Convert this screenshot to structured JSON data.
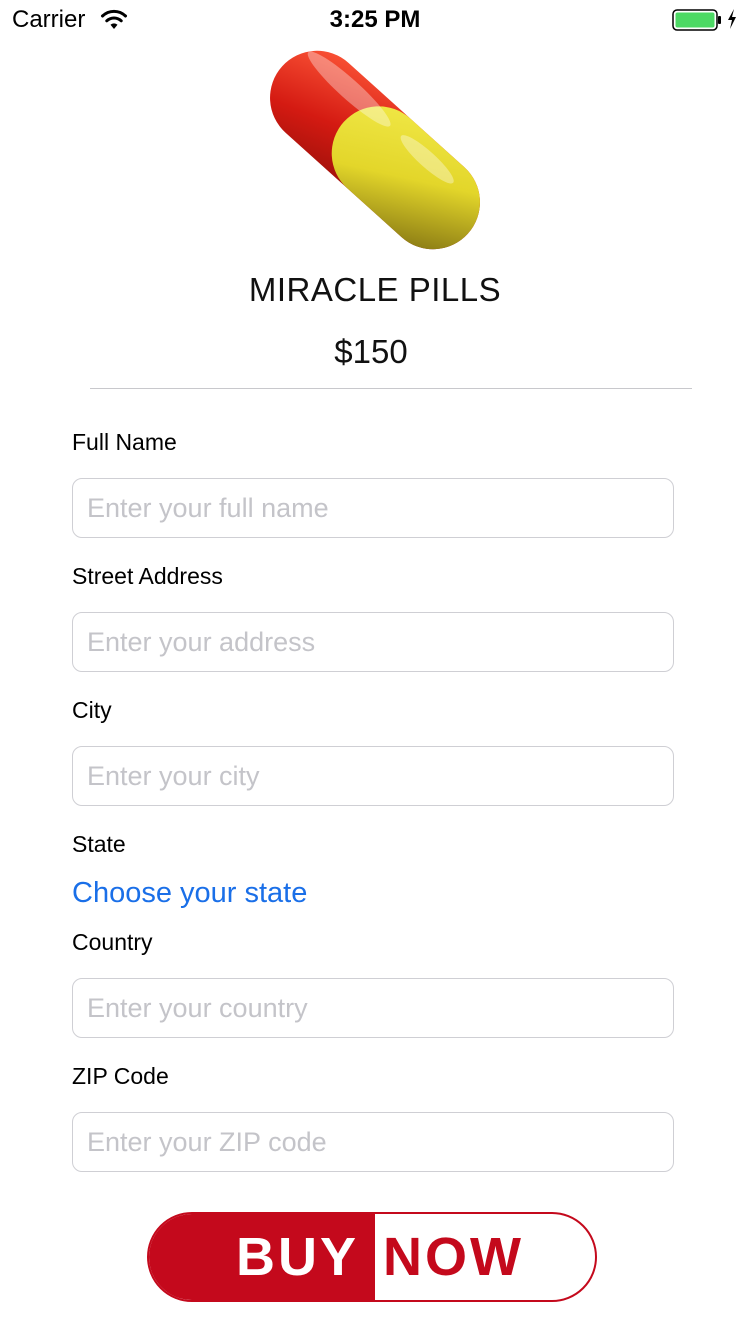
{
  "status_bar": {
    "carrier": "Carrier",
    "time": "3:25 PM",
    "battery_color": "#4cd964"
  },
  "product": {
    "name": "MIRACLE PILLS",
    "price": "$150",
    "image_icon": "pill-capsule-icon",
    "pill_colors": {
      "red": "#d41a12",
      "yellow": "#e3d62a"
    }
  },
  "form": {
    "full_name": {
      "label": "Full Name",
      "placeholder": "Enter your full name",
      "value": ""
    },
    "street_address": {
      "label": "Street Address",
      "placeholder": "Enter your address",
      "value": ""
    },
    "city": {
      "label": "City",
      "placeholder": "Enter your city",
      "value": ""
    },
    "state": {
      "label": "State",
      "link_text": "Choose your state"
    },
    "country": {
      "label": "Country",
      "placeholder": "Enter your country",
      "value": ""
    },
    "zip": {
      "label": "ZIP Code",
      "placeholder": "Enter your ZIP code",
      "value": ""
    }
  },
  "buy_button": {
    "left_text": "BUY",
    "right_text": "NOW",
    "accent": "#c4091c"
  },
  "colors": {
    "link": "#1a6fe8",
    "placeholder": "#c4c4c9",
    "border": "#cfcfd4"
  }
}
